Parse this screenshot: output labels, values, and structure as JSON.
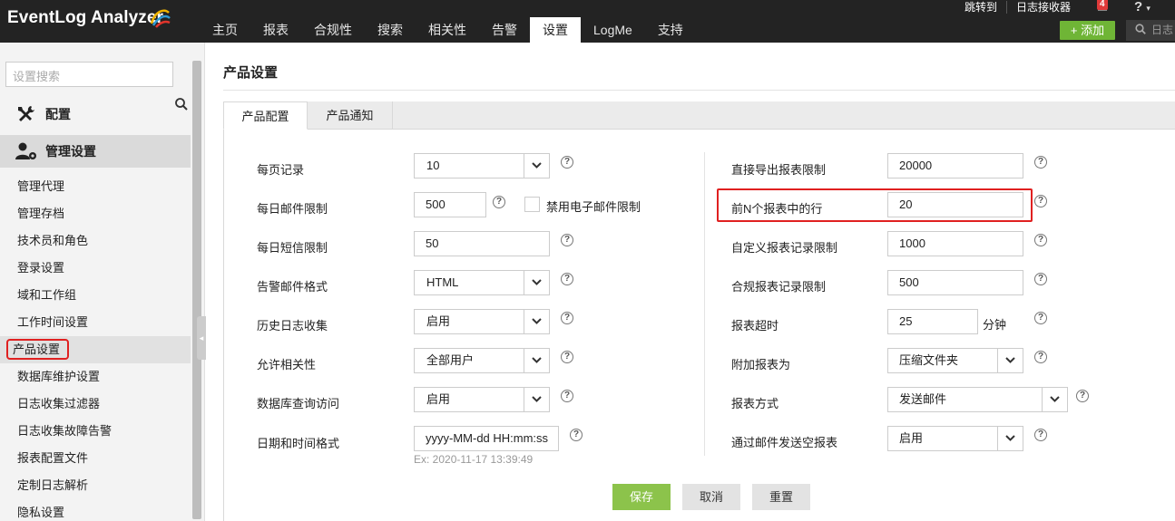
{
  "app": {
    "logo_text": "EventLog Analyzer",
    "top_links": [
      "跳转到",
      "日志接收器"
    ],
    "notification_count": "4",
    "help_label": "?",
    "add_label": "+ 添加",
    "top_search_placeholder": "日志",
    "nav_tabs": [
      "主页",
      "报表",
      "合规性",
      "搜索",
      "相关性",
      "告警",
      "设置",
      "LogMe",
      "支持"
    ],
    "active_nav": "设置"
  },
  "sidebar": {
    "search_placeholder": "设置搜索",
    "config_label": "配置",
    "mgmt_label": "管理设置",
    "items": [
      "管理代理",
      "管理存档",
      "技术员和角色",
      "登录设置",
      "域和工作组",
      "工作时间设置",
      "产品设置",
      "数据库维护设置",
      "日志收集过滤器",
      "日志收集故障告警",
      "报表配置文件",
      "定制日志解析",
      "隐私设置"
    ],
    "active_item": "产品设置"
  },
  "page": {
    "title": "产品设置",
    "tabs": [
      "产品配置",
      "产品通知"
    ]
  },
  "left_form": {
    "rows_per_page": {
      "label": "每页记录",
      "value": "10"
    },
    "daily_mail_limit": {
      "label": "每日邮件限制",
      "value": "500",
      "checkbox_label": "禁用电子邮件限制"
    },
    "daily_sms_limit": {
      "label": "每日短信限制",
      "value": "50"
    },
    "alert_mail_format": {
      "label": "告警邮件格式",
      "value": "HTML"
    },
    "history_log_collection": {
      "label": "历史日志收集",
      "value": "启用"
    },
    "allow_correlation": {
      "label": "允许相关性",
      "value": "全部用户"
    },
    "db_query_access": {
      "label": "数据库查询访问",
      "value": "启用"
    },
    "datetime_format": {
      "label": "日期和时间格式",
      "value": "yyyy-MM-dd HH:mm:ss",
      "example": "Ex: 2020-11-17 13:39:49"
    }
  },
  "right_form": {
    "direct_export_limit": {
      "label": "直接导出报表限制",
      "value": "20000"
    },
    "top_n_rows": {
      "label": "前N个报表中的行",
      "value": "20"
    },
    "custom_report_limit": {
      "label": "自定义报表记录限制",
      "value": "1000"
    },
    "compliance_report_limit": {
      "label": "合规报表记录限制",
      "value": "500"
    },
    "report_timeout": {
      "label": "报表超时",
      "value": "25",
      "unit": "分钟"
    },
    "attach_report_as": {
      "label": "附加报表为",
      "value": "压缩文件夹"
    },
    "report_method": {
      "label": "报表方式",
      "value": "发送邮件"
    },
    "send_empty_report": {
      "label": "通过邮件发送空报表",
      "value": "启用"
    }
  },
  "buttons": {
    "save": "保存",
    "cancel": "取消",
    "reset": "重置"
  },
  "colors": {
    "topbar": "#232323",
    "accent_green": "#8cc34b",
    "highlight_red": "#e02020"
  }
}
